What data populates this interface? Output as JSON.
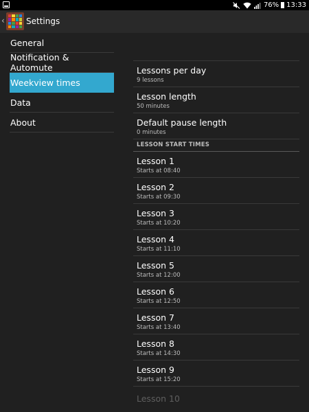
{
  "status_bar": {
    "battery_text": "76%",
    "time": "13:33",
    "icons": [
      "notification-icon",
      "mute-icon",
      "wifi-icon",
      "signal-icon",
      "battery-icon"
    ]
  },
  "action_bar": {
    "title": "Settings",
    "icon": "app-grid-icon",
    "up_glyph": "‹"
  },
  "nav": {
    "items": [
      {
        "label": "General"
      },
      {
        "label": "Notification & Automute"
      },
      {
        "label": "Weekview times",
        "active": true
      },
      {
        "label": "Data"
      },
      {
        "label": "About"
      }
    ]
  },
  "prefs": {
    "lessons_per_day": {
      "title": "Lessons per day",
      "summary": "9 lessons"
    },
    "lesson_length": {
      "title": "Lesson length",
      "summary": "50 minutes"
    },
    "default_pause": {
      "title": "Default pause length",
      "summary": "0 minutes"
    },
    "category_start_times": "LESSON START TIMES",
    "lessons": [
      {
        "title": "Lesson 1",
        "summary": "Starts at 08:40"
      },
      {
        "title": "Lesson 2",
        "summary": "Starts at 09:30"
      },
      {
        "title": "Lesson 3",
        "summary": "Starts at 10:20"
      },
      {
        "title": "Lesson 4",
        "summary": "Starts at 11:10"
      },
      {
        "title": "Lesson 5",
        "summary": "Starts at 12:00"
      },
      {
        "title": "Lesson 6",
        "summary": "Starts at 12:50"
      },
      {
        "title": "Lesson 7",
        "summary": "Starts at 13:40"
      },
      {
        "title": "Lesson 8",
        "summary": "Starts at 14:30"
      },
      {
        "title": "Lesson 9",
        "summary": "Starts at 15:20"
      },
      {
        "title": "Lesson 10",
        "disabled": true
      }
    ]
  },
  "colors": {
    "accent": "#33a8cf",
    "background": "#202020",
    "action_bar": "#292929",
    "divider": "#3a3a3a",
    "secondary_text": "#bdbdbd",
    "disabled_text": "#5f5f5f"
  }
}
